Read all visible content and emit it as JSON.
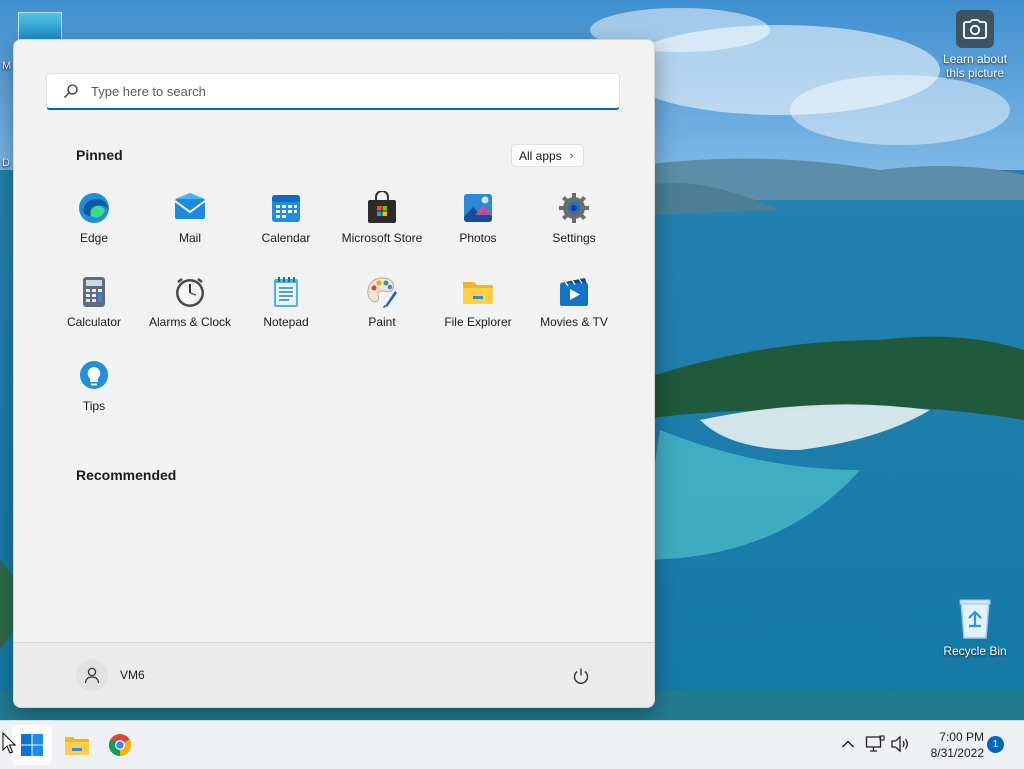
{
  "desktop": {
    "learn_about_picture": "Learn about this picture",
    "recycle_bin": "Recycle Bin",
    "edge_letters": [
      "M",
      "D"
    ]
  },
  "start_menu": {
    "search_placeholder": "Type here to search",
    "pinned_title": "Pinned",
    "all_apps_label": "All apps",
    "pinned_apps": [
      {
        "label": "Edge",
        "icon": "edge-icon"
      },
      {
        "label": "Mail",
        "icon": "mail-icon"
      },
      {
        "label": "Calendar",
        "icon": "calendar-icon"
      },
      {
        "label": "Microsoft Store",
        "icon": "store-icon"
      },
      {
        "label": "Photos",
        "icon": "photos-icon"
      },
      {
        "label": "Settings",
        "icon": "gear-icon"
      },
      {
        "label": "Calculator",
        "icon": "calculator-icon"
      },
      {
        "label": "Alarms & Clock",
        "icon": "clock-icon"
      },
      {
        "label": "Notepad",
        "icon": "notepad-icon"
      },
      {
        "label": "Paint",
        "icon": "paint-icon"
      },
      {
        "label": "File Explorer",
        "icon": "folder-icon"
      },
      {
        "label": "Movies & TV",
        "icon": "movies-icon"
      },
      {
        "label": "Tips",
        "icon": "tips-icon"
      }
    ],
    "recommended_title": "Recommended",
    "user_name": "VM6"
  },
  "taskbar": {
    "time": "7:00 PM",
    "date": "8/31/2022",
    "notification_count": "1"
  },
  "colors": {
    "accent": "#0067c0",
    "start_bg": "#f2f2f2",
    "taskbar_bg": "#eef0f3"
  }
}
